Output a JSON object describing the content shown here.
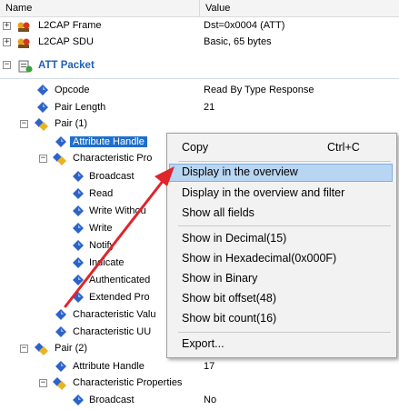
{
  "header": {
    "col_name": "Name",
    "col_value": "Value"
  },
  "rows": [
    {
      "label": "L2CAP Frame",
      "value": "Dst=0x0004 (ATT)"
    },
    {
      "label": "L2CAP SDU",
      "value": "Basic, 65 bytes"
    },
    {
      "label": "ATT Packet",
      "value": ""
    },
    {
      "label": "Opcode",
      "value": "Read By Type Response"
    },
    {
      "label": "Pair Length",
      "value": "21"
    },
    {
      "label": "Pair (1)",
      "value": ""
    },
    {
      "label": "Attribute Handle",
      "value": ""
    },
    {
      "label": "Characteristic Pro",
      "value": ""
    },
    {
      "label": "Broadcast",
      "value": ""
    },
    {
      "label": "Read",
      "value": ""
    },
    {
      "label": "Write Withou",
      "value": ""
    },
    {
      "label": "Write",
      "value": ""
    },
    {
      "label": "Notify",
      "value": ""
    },
    {
      "label": "Indicate",
      "value": ""
    },
    {
      "label": "Authenticated",
      "value": ""
    },
    {
      "label": "Extended Pro",
      "value": ""
    },
    {
      "label": "Characteristic Valu",
      "value": ""
    },
    {
      "label": "Characteristic UU",
      "value": ""
    },
    {
      "label": "Pair (2)",
      "value": ""
    },
    {
      "label": "Attribute Handle",
      "value": "17"
    },
    {
      "label": "Characteristic Properties",
      "value": ""
    },
    {
      "label": "Broadcast",
      "value": "No"
    }
  ],
  "menu": {
    "copy": {
      "label": "Copy",
      "shortcut": "Ctrl+C"
    },
    "display_overview": "Display in the overview",
    "display_overview_filter": "Display in the overview and filter",
    "show_all_fields": "Show all fields",
    "show_decimal": "Show in Decimal(15)",
    "show_hex": "Show in Hexadecimal(0x000F)",
    "show_binary": "Show in Binary",
    "show_bit_offset": "Show bit offset(48)",
    "show_bit_count": "Show bit count(16)",
    "export": "Export..."
  },
  "colors": {
    "selection": "#1e6fcc",
    "menu_highlight": "#b8d5f2",
    "arrow": "#e0242b",
    "att_title": "#1f5fb8"
  }
}
